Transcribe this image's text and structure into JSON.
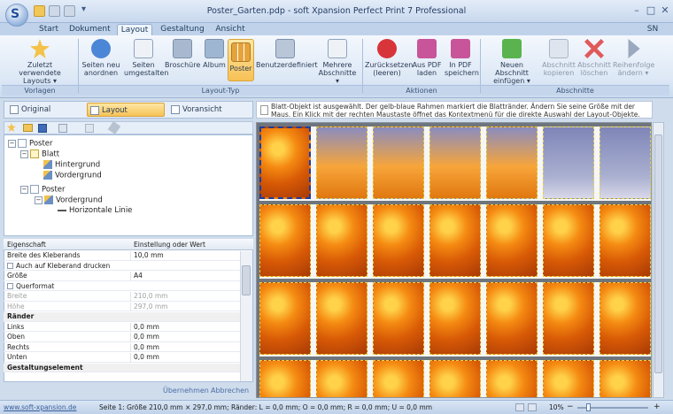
{
  "window": {
    "title": "Poster_Garten.pdp - soft Xpansion Perfect Print 7 Professional",
    "help_label": "SN"
  },
  "tabs": [
    "Start",
    "Dokument",
    "Layout",
    "Gestaltung",
    "Ansicht"
  ],
  "ribbon": {
    "buttons": [
      {
        "label": "Zuletzt verwendete Layouts ▾",
        "color": "#f3c24a"
      },
      {
        "label": "Seiten neu anordnen",
        "color": "#4c86d6"
      },
      {
        "label": "Seiten umgestalten",
        "color": "#c9d4e3"
      },
      {
        "label": "Broschüre",
        "color": "#a8b9cf"
      },
      {
        "label": "Album",
        "color": "#9fb6d3"
      },
      {
        "label": "Poster",
        "color": "#e6a33c"
      },
      {
        "label": "Benutzerdefiniert",
        "color": "#b8c6d8"
      },
      {
        "label": "Mehrere Abschnitte ▾",
        "color": "#cfd8e6"
      },
      {
        "label": "Zurücksetzen (leeren)",
        "color": "#d7353a"
      },
      {
        "label": "Aus PDF laden",
        "color": "#c8559a"
      },
      {
        "label": "In PDF speichern",
        "color": "#c8559a"
      },
      {
        "label": "Neuen Abschnitt einfügen ▾",
        "color": "#5ab34e"
      },
      {
        "label": "Abschnitt kopieren",
        "color": "#a9b6c8"
      },
      {
        "label": "Abschnitt löschen",
        "color": "#e05a5a"
      },
      {
        "label": "Reihenfolge ändern ▾",
        "color": "#9aa9c0"
      }
    ],
    "groups": [
      "Vorlagen",
      "Layout-Typ",
      "Aktionen",
      "Abschnitte"
    ]
  },
  "views": [
    "Original",
    "Layout",
    "Voransicht"
  ],
  "tree": [
    {
      "label": "Poster"
    },
    {
      "label": "Blatt"
    },
    {
      "label": "Hintergrund"
    },
    {
      "label": "Vordergrund"
    },
    {
      "label": "Poster"
    },
    {
      "label": "Vordergrund"
    },
    {
      "label": "Horizontale Linie"
    }
  ],
  "properties": {
    "header_key": "Eigenschaft",
    "header_value": "Einstellung oder Wert",
    "rows": [
      {
        "key": "Breite des Kleberands",
        "value": "10,0 mm"
      },
      {
        "key": "Auch auf Kleberand drucken",
        "value": ""
      },
      {
        "key": "Größe",
        "value": "A4"
      },
      {
        "key": "Querformat",
        "value": ""
      },
      {
        "key": "Breite",
        "value": "210,0 mm"
      },
      {
        "key": "Höhe",
        "value": "297,0 mm"
      },
      {
        "key": "Ränder",
        "value": ""
      },
      {
        "key": "Links",
        "value": "0,0 mm"
      },
      {
        "key": "Oben",
        "value": "0,0 mm"
      },
      {
        "key": "Rechts",
        "value": "0,0 mm"
      },
      {
        "key": "Unten",
        "value": "0,0 mm"
      },
      {
        "key": "Gestaltungselement",
        "value": ""
      }
    ],
    "apply_label": "Übernehmen",
    "cancel_label": "Abbrechen"
  },
  "hint": "Blatt-Objekt ist ausgewählt. Der gelb-blaue Rahmen markiert die Blattränder. Ändern Sie seine Größe mit der Maus. Ein Klick mit der rechten Maustaste öffnet das Kontextmenü für die direkte Auswahl der Layout-Objekte.",
  "status": {
    "link": "www.soft-xpansion.de",
    "page_info": "Seite 1: Größe 210,0 mm × 297,0 mm; Ränder: L = 0,0 mm; O = 0,0 mm; R = 0,0 mm; U = 0,0 mm",
    "zoom": "10%"
  }
}
